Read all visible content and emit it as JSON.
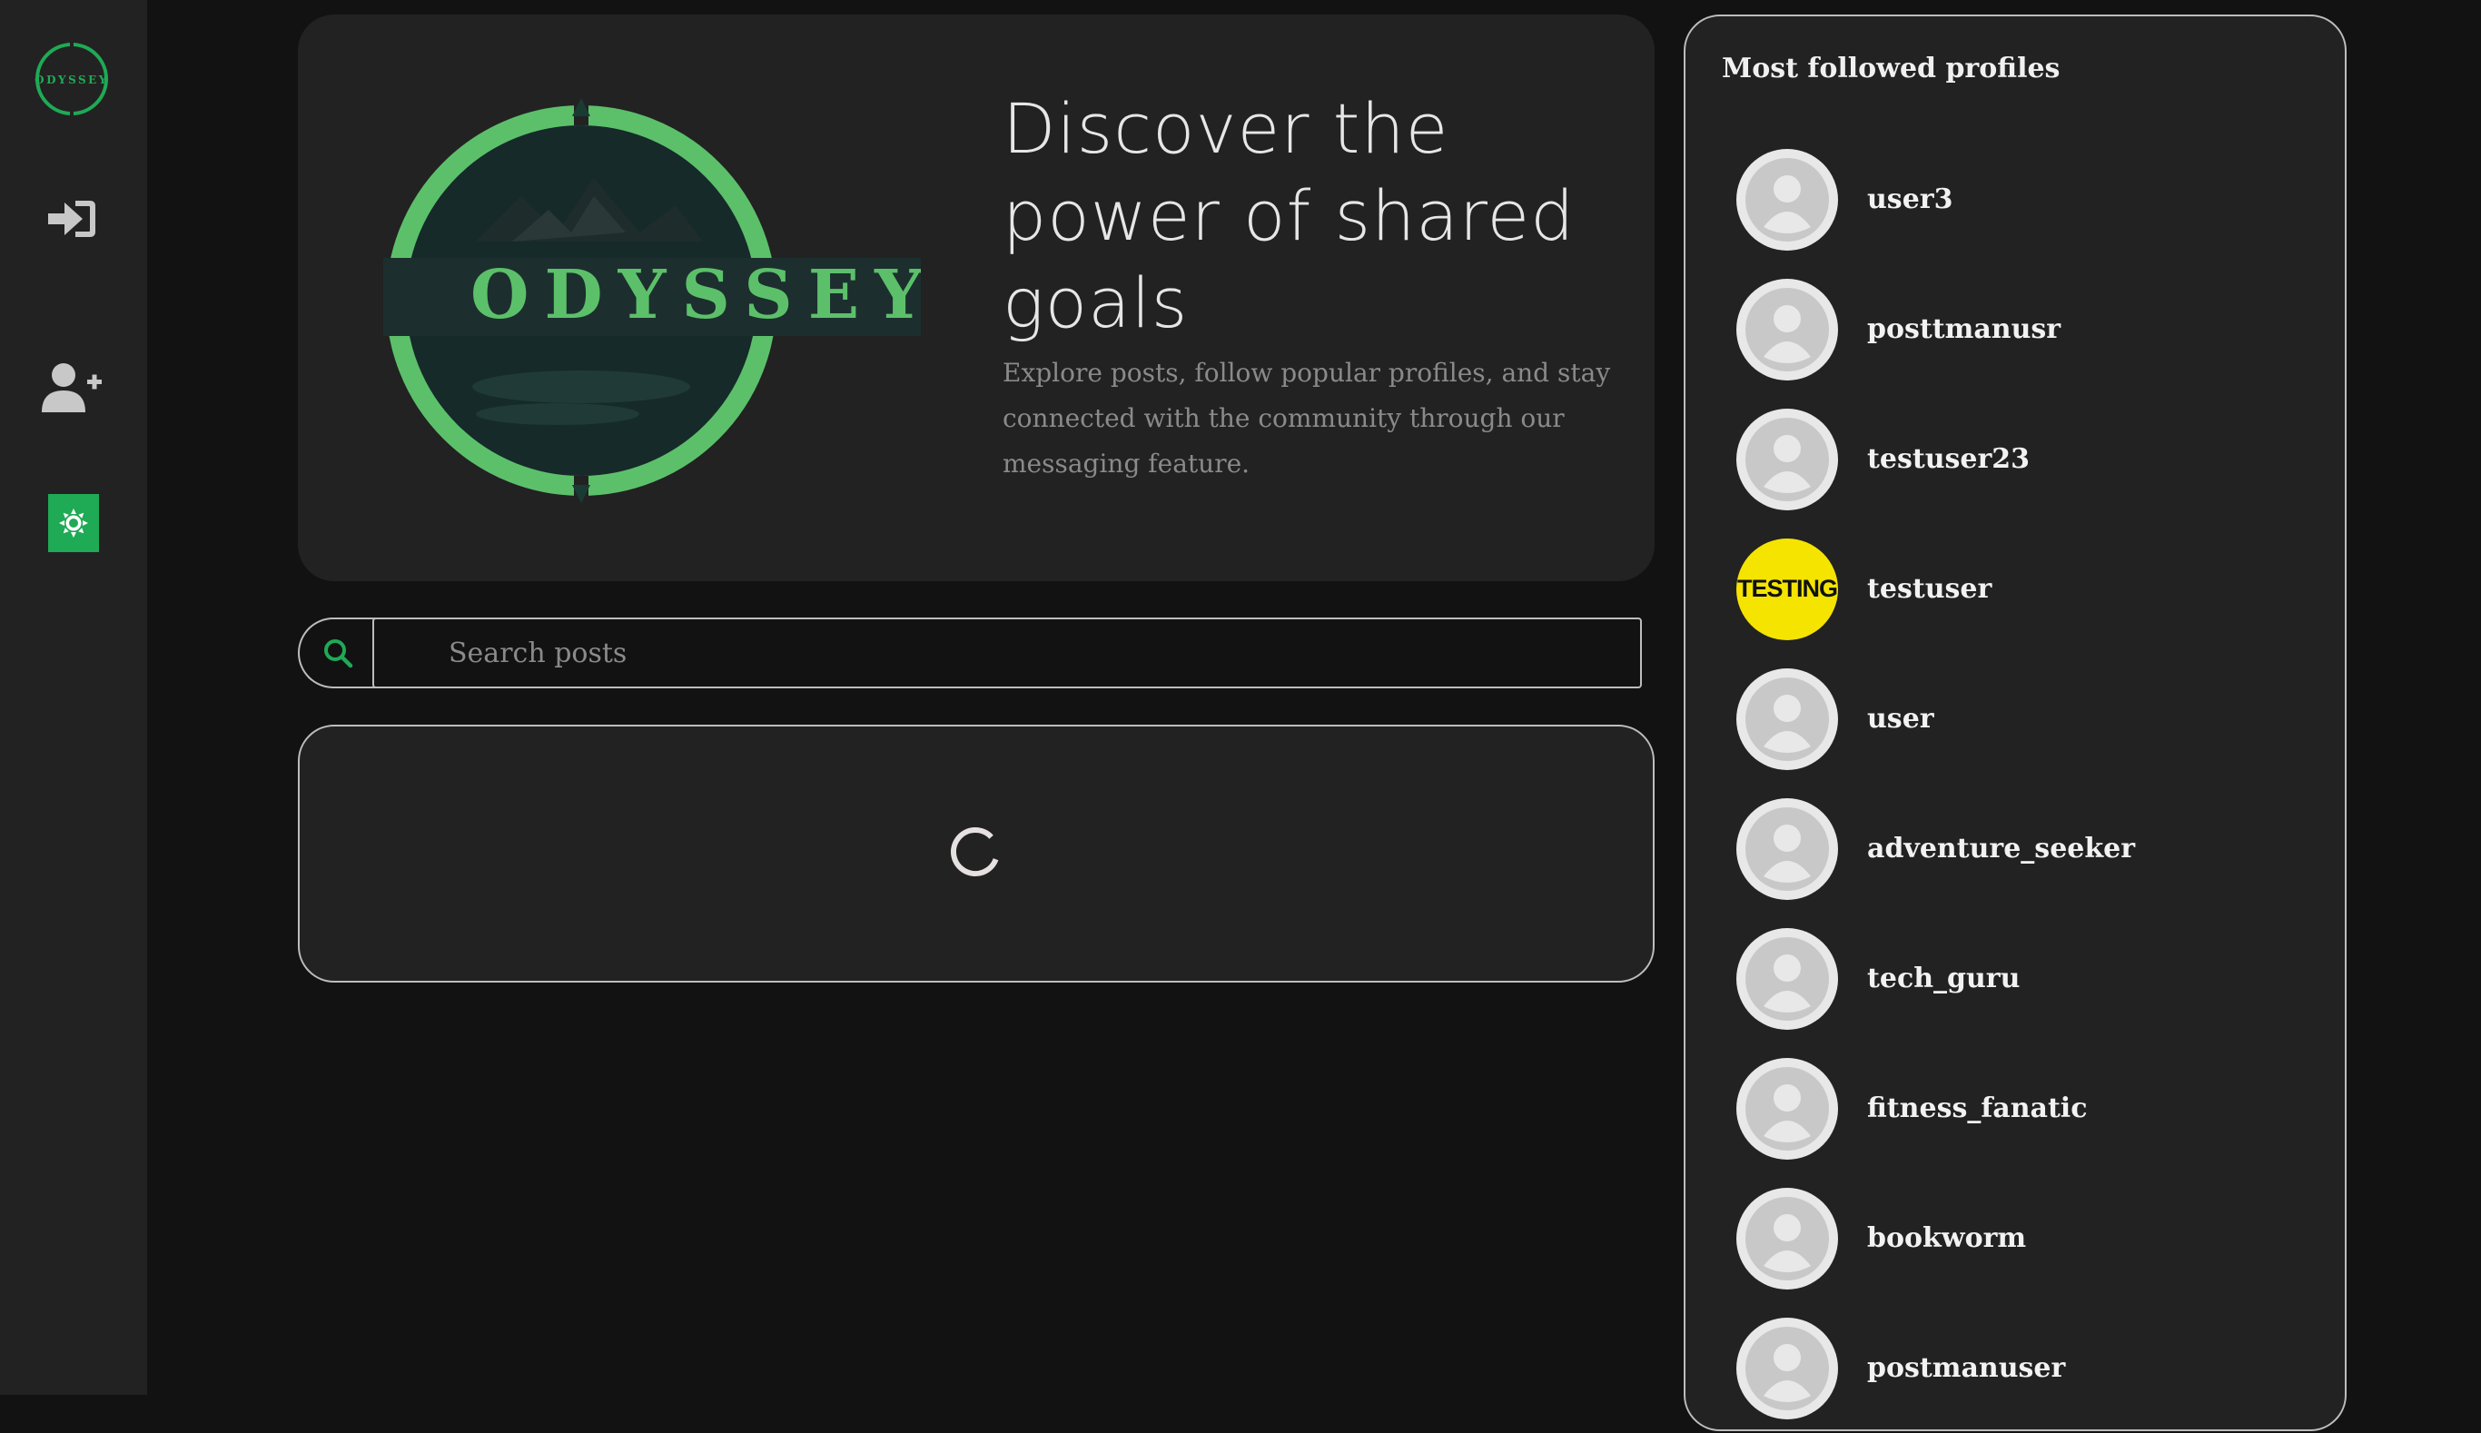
{
  "sidebar": {
    "logo_text": "ODYSSEY",
    "buttons": [
      {
        "name": "login",
        "icon": "sign-in-icon"
      },
      {
        "name": "register",
        "icon": "user-plus-icon"
      },
      {
        "name": "theme",
        "icon": "sun-icon"
      }
    ]
  },
  "hero": {
    "logo_text": "ODYSSEY",
    "title": "Discover the power of shared goals",
    "subtitle": "Explore posts, follow popular profiles, and stay connected with the community through our messaging feature."
  },
  "search": {
    "placeholder": "Search posts",
    "value": ""
  },
  "posts": {
    "status": "loading"
  },
  "profiles": {
    "title": "Most followed profiles",
    "items": [
      {
        "username": "user3",
        "avatar": "default"
      },
      {
        "username": "posttmanusr",
        "avatar": "default"
      },
      {
        "username": "testuser23",
        "avatar": "default"
      },
      {
        "username": "testuser",
        "avatar": "testing",
        "avatar_text": "TESTING"
      },
      {
        "username": "user",
        "avatar": "default"
      },
      {
        "username": "adventure_seeker",
        "avatar": "default"
      },
      {
        "username": "tech_guru",
        "avatar": "default"
      },
      {
        "username": "fitness_fanatic",
        "avatar": "default"
      },
      {
        "username": "bookworm",
        "avatar": "default"
      },
      {
        "username": "postmanuser",
        "avatar": "default"
      }
    ]
  },
  "colors": {
    "accent": "#1faa55",
    "logo_green": "#5cc06a",
    "background": "#121212",
    "panel": "#222222",
    "avatar_yellow": "#f5e400"
  }
}
